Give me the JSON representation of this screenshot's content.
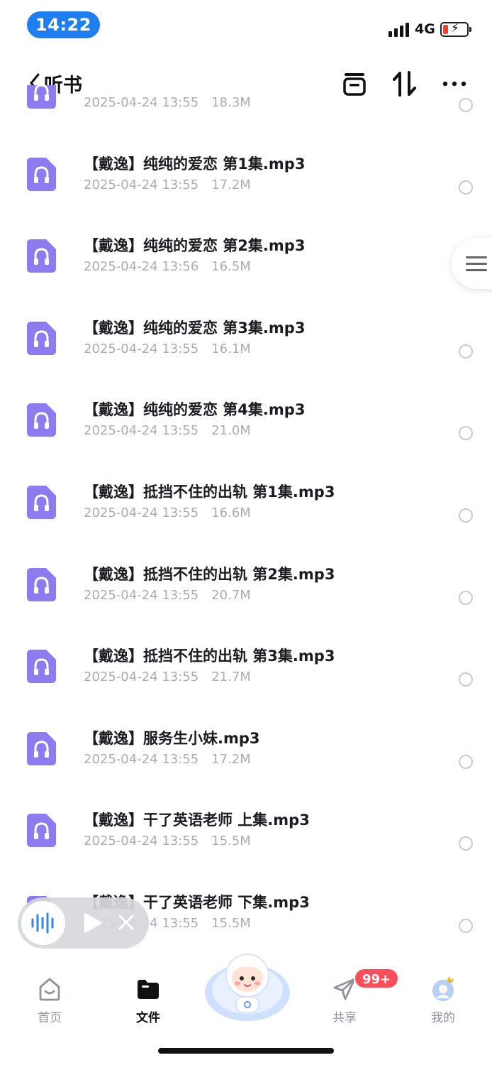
{
  "status_bar": {
    "time": "14:22",
    "network": "4G"
  },
  "header": {
    "title": "听书"
  },
  "files": [
    {
      "name": "",
      "date": "2025-04-24 13:55",
      "size": "18.3M"
    },
    {
      "name": "【戴逸】纯纯的爱恋 第1集.mp3",
      "date": "2025-04-24 13:55",
      "size": "17.2M"
    },
    {
      "name": "【戴逸】纯纯的爱恋 第2集.mp3",
      "date": "2025-04-24 13:56",
      "size": "16.5M"
    },
    {
      "name": "【戴逸】纯纯的爱恋 第3集.mp3",
      "date": "2025-04-24 13:55",
      "size": "16.1M"
    },
    {
      "name": "【戴逸】纯纯的爱恋 第4集.mp3",
      "date": "2025-04-24 13:55",
      "size": "21.0M"
    },
    {
      "name": "【戴逸】抵挡不住的出轨 第1集.mp3",
      "date": "2025-04-24 13:55",
      "size": "16.6M"
    },
    {
      "name": "【戴逸】抵挡不住的出轨 第2集.mp3",
      "date": "2025-04-24 13:55",
      "size": "20.7M"
    },
    {
      "name": "【戴逸】抵挡不住的出轨 第3集.mp3",
      "date": "2025-04-24 13:55",
      "size": "21.7M"
    },
    {
      "name": "【戴逸】服务生小妹.mp3",
      "date": "2025-04-24 13:55",
      "size": "17.2M"
    },
    {
      "name": "【戴逸】干了英语老师 上集.mp3",
      "date": "2025-04-24 13:55",
      "size": "15.5M"
    },
    {
      "name": "【戴逸】干了英语老师 下集.mp3",
      "date": "2025-04-24 13:55",
      "size": "15.5M"
    }
  ],
  "nav": {
    "home": "首页",
    "files": "文件",
    "share": "共享",
    "share_badge": "99+",
    "mine": "我的"
  },
  "colors": {
    "accent": "#1f7ff2",
    "file_icon": "#8c7cf0",
    "badge": "#ff4d5a",
    "meta_text": "#a9acb4"
  },
  "icons": {
    "file": "headphones-icon",
    "back": "chevron-left-icon",
    "minimize": "window-icon",
    "sort": "sort-arrows-icon",
    "more": "more-icon"
  }
}
